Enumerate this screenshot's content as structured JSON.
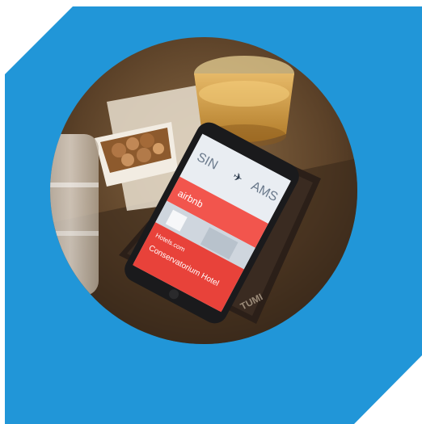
{
  "colors": {
    "background": "#ffffff",
    "accent_blue": "#2196d8",
    "screen_red": "#e8423a",
    "airbnb_red": "#f2554d"
  },
  "photo": {
    "phone_screen": {
      "boarding_pass": {
        "from_code": "SIN",
        "to_code": "AMS"
      },
      "airbnb_label": "airbnb",
      "hotels_brand": "Hotels.com",
      "hotel_name": "Conservatorium Hotel"
    },
    "wallet_logo": "TUMI"
  }
}
